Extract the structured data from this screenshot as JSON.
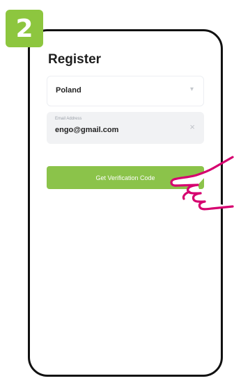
{
  "step": {
    "number": "2",
    "color": "#8dc63f"
  },
  "screen": {
    "title": "Register",
    "country_select": {
      "value": "Poland",
      "icon": "chevron-down-icon"
    },
    "email_field": {
      "placeholder": "Email Address",
      "value": "engo@gmail.com",
      "clear_icon": "close-icon"
    },
    "verify_button": {
      "label": "Get Verification Code",
      "color": "#8bc34a"
    }
  },
  "pointer": {
    "icon": "pointing-hand-icon",
    "color": "#d6006f"
  }
}
